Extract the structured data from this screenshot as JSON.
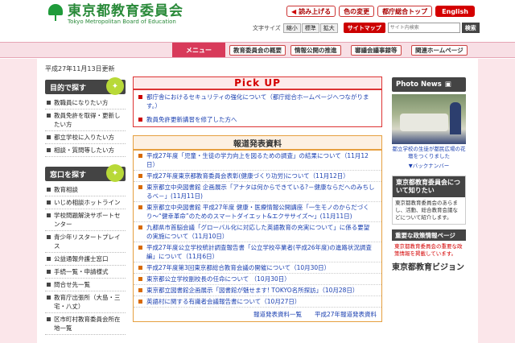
{
  "header": {
    "logo_jp": "東京都教育委員会",
    "logo_en": "Tokyo Metropolitan Board of Education",
    "util": [
      "読み上げる",
      "色の変更",
      "都庁総合トップ"
    ],
    "english": "English",
    "font_size_label": "文字サイズ",
    "sizes": [
      "縮小",
      "標準",
      "拡大"
    ],
    "sitemap": "サイトマップ",
    "search_placeholder": "サイト内検索",
    "search_button": "検索"
  },
  "nav": {
    "menu": "メニュー",
    "items": [
      "教育委員会の概要",
      "情報公開の推進",
      "審議会議事録等",
      "関連ホームページ"
    ]
  },
  "left": {
    "updated": "平成27年11月13日更新",
    "section1_title": "目的で探す",
    "section1_items": [
      "教職員になりたい方",
      "教員免許を取得・更新したい方",
      "都立学校に入りたい方",
      "相談・質問等したい方"
    ],
    "section2_title": "窓口を探す",
    "section2_items": [
      "教育相談",
      "いじめ相談ホットライン",
      "学校問題解決サポートセンター",
      "青少年リスタートプレイス",
      "公益通報弁護士窓口",
      "手続一覧・申請様式",
      "問合せ先一覧",
      "教育庁出張所（大島・三宅・八丈）",
      "区市町村教育委員会所在地一覧"
    ]
  },
  "pickup": {
    "title": "Pick UP",
    "items": [
      "都庁舎におけるセキュリティの強化について（都庁総合ホームページへつながります。）",
      "教員免許更新講習を修了した方へ"
    ]
  },
  "press": {
    "title": "報道発表資料",
    "items": [
      "平成27年度「児童・生徒の学力向上を図るための調査」の結果について（11月12日）",
      "平成27年度東京都教育委員会表彰(健康づくり功労)について（11月12日）",
      "東京都立中央図書館 企画展示「アナタは何からできている?－健康ならだへのみちしるべ－」(11月11日)",
      "東京都立中央図書館 平成27年度 健康・医療情報公開講座「一生モノのからだづくり～“健幸革命”のためのスマートダイエット&エクササイズ～」(11月11日)",
      "九都県市首脳会議「グローバル化に対応した英語教育の充実について」に係る要望の実施について（11月10日）",
      "平成27年度公立学校統計調査報告書「公立学校卒業者(平成26年度)の進路状況調査編」について（11月6日）",
      "平成27年度第3回東京都総合教育会議の開催について（10月30日）",
      "東京都公立学校副校長の任命について （10月30日）",
      "東京都立図書館企画展示「図書館が魅せます! TOKYO名所探訪」（10月28日）",
      "英語村に関する有識者会議報告書について（10月27日）"
    ],
    "more": "報道発表資料一覧",
    "year_list": "平成27年報道発表資料"
  },
  "right": {
    "photo_news": "Photo News",
    "caption": "都立学校の生徒が都民広場の花壇をつくりました",
    "back_number": "▼バックナンバー",
    "about_title": "東京都教育委員会について知りたい",
    "about_body": "東京都教育委員会のあらまし、活動、総合教育会議などについて紹介します。",
    "policy_title": "重要な政策情報ページ",
    "policy_body": "東京都教育委員会の重要な政策情報を掲載しています。",
    "vision": "東京都教育ビジョン"
  },
  "colors": {
    "accent_red": "#d40000",
    "brand_green": "#2a8a3a",
    "nav_pink": "#f8dfe5",
    "link_blue": "#1a3fb0"
  }
}
